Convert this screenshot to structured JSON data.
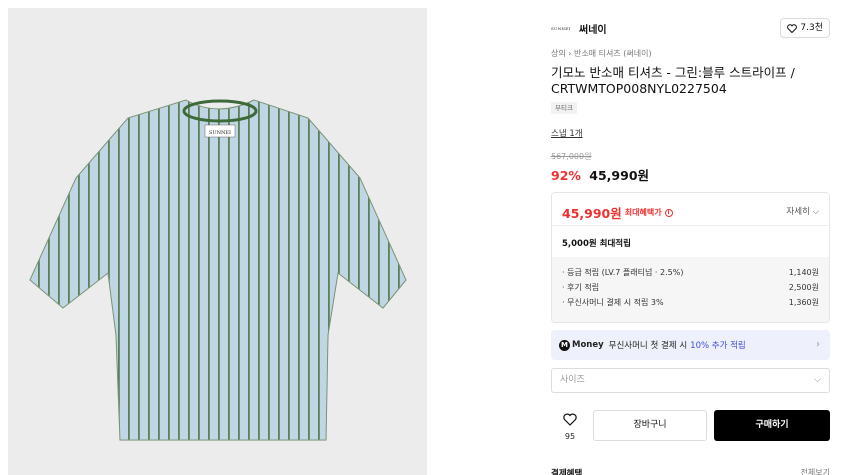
{
  "product_image": {
    "description_icon": "striped-tshirt-image"
  },
  "brand": {
    "logo_text": "SUNNEI",
    "name": "써네이"
  },
  "like": {
    "count": "7.3천",
    "icon": "heart-icon"
  },
  "breadcrumb": "상의 › 반소매 티셔츠 (써네이)",
  "title": "기모노 반소매 티셔츠 - 그린:블루 스트라이프 / CRTWMTOP008NYL0227504",
  "tag": "부티크",
  "snap": "스냅 1개",
  "price": {
    "original": "567,000원",
    "discount": "92%",
    "sale": "45,990원"
  },
  "benefit": {
    "max_price": "45,990원",
    "max_label": "최대혜택가",
    "detail_label": "자세히",
    "points_total": "5,000원 최대적립",
    "points": [
      {
        "label": "· 등급 적립 (LV.7 플래티넘 · 2.5%)",
        "value": "1,140원"
      },
      {
        "label": "· 후기 적립",
        "value": "2,500원"
      },
      {
        "label": "· 무신사머니 결제 시 적립 3%",
        "value": "1,360원"
      }
    ]
  },
  "money_banner": {
    "logo": "M",
    "brand": "Money",
    "text": "무신사머니 첫 결제 시",
    "accent": "10% 추가 적립"
  },
  "size_select": {
    "placeholder": "사이즈"
  },
  "wishlist": {
    "count": "95"
  },
  "buttons": {
    "cart": "장바구니",
    "buy": "구매하기"
  },
  "payment": {
    "label": "결제혜택",
    "more": "전체보기"
  },
  "colors": {
    "accent_red": "#ef3030",
    "money_blue": "#3d4de0",
    "buy_bg": "#000000"
  }
}
